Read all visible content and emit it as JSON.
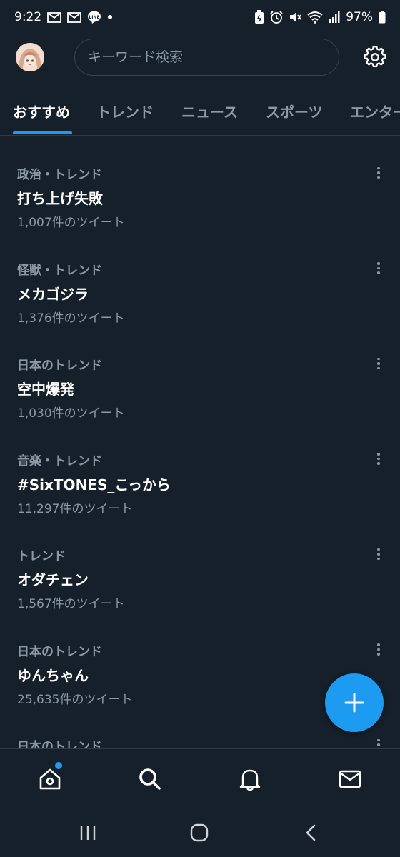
{
  "status_bar": {
    "time": "9:22",
    "battery": "97%",
    "left_icons": [
      "mail-icon",
      "mail-icon",
      "line-app-icon",
      "dot-icon"
    ],
    "right_icons": [
      "battery-saver-icon",
      "alarm-icon",
      "mute-icon",
      "wifi-icon",
      "signal-icon",
      "battery-icon"
    ]
  },
  "header": {
    "search_placeholder": "キーワード検索",
    "settings_icon": "gear-icon"
  },
  "tabs": [
    {
      "label": "おすすめ",
      "active": true
    },
    {
      "label": "トレンド",
      "active": false
    },
    {
      "label": "ニュース",
      "active": false
    },
    {
      "label": "スポーツ",
      "active": false
    },
    {
      "label": "エンター",
      "active": false
    }
  ],
  "trends": [
    {
      "category": "政治・トレンド",
      "title": "打ち上げ失敗",
      "count": "1,007件のツイート"
    },
    {
      "category": "怪獣・トレンド",
      "title": "メカゴジラ",
      "count": "1,376件のツイート"
    },
    {
      "category": "日本のトレンド",
      "title": "空中爆発",
      "count": "1,030件のツイート"
    },
    {
      "category": "音楽・トレンド",
      "title": "#SixTONES_こっから",
      "count": "11,297件のツイート"
    },
    {
      "category": "トレンド",
      "title": "オダチェン",
      "count": "1,567件のツイート"
    },
    {
      "category": "日本のトレンド",
      "title": "ゆんちゃん",
      "count": "25,635件のツイート"
    },
    {
      "category": "日本のトレンド",
      "title": "",
      "count": ""
    }
  ],
  "fab": {
    "icon": "plus-icon"
  },
  "bottom_nav": [
    "home-icon",
    "search-icon",
    "bell-icon",
    "mail-icon"
  ],
  "system_nav": [
    "recent-apps-icon",
    "home-button-icon",
    "back-icon"
  ],
  "colors": {
    "background": "#15202b",
    "accent": "#1d9bf0",
    "secondary_text": "#8b98a5",
    "border": "#2f3b47"
  }
}
